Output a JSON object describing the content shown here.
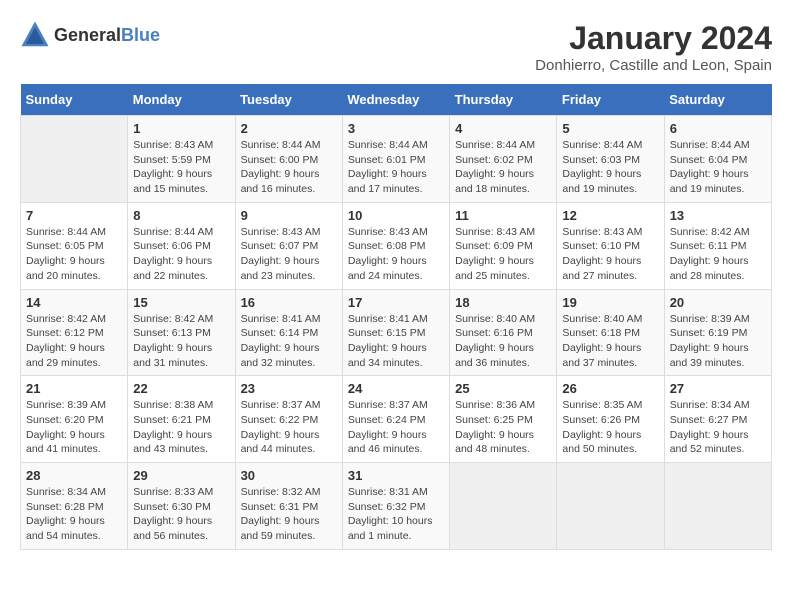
{
  "header": {
    "logo_general": "General",
    "logo_blue": "Blue",
    "month_title": "January 2024",
    "location": "Donhierro, Castille and Leon, Spain"
  },
  "calendar": {
    "days_of_week": [
      "Sunday",
      "Monday",
      "Tuesday",
      "Wednesday",
      "Thursday",
      "Friday",
      "Saturday"
    ],
    "weeks": [
      [
        {
          "day": "",
          "info": ""
        },
        {
          "day": "1",
          "info": "Sunrise: 8:43 AM\nSunset: 5:59 PM\nDaylight: 9 hours\nand 15 minutes."
        },
        {
          "day": "2",
          "info": "Sunrise: 8:44 AM\nSunset: 6:00 PM\nDaylight: 9 hours\nand 16 minutes."
        },
        {
          "day": "3",
          "info": "Sunrise: 8:44 AM\nSunset: 6:01 PM\nDaylight: 9 hours\nand 17 minutes."
        },
        {
          "day": "4",
          "info": "Sunrise: 8:44 AM\nSunset: 6:02 PM\nDaylight: 9 hours\nand 18 minutes."
        },
        {
          "day": "5",
          "info": "Sunrise: 8:44 AM\nSunset: 6:03 PM\nDaylight: 9 hours\nand 19 minutes."
        },
        {
          "day": "6",
          "info": "Sunrise: 8:44 AM\nSunset: 6:04 PM\nDaylight: 9 hours\nand 19 minutes."
        }
      ],
      [
        {
          "day": "7",
          "info": "Sunrise: 8:44 AM\nSunset: 6:05 PM\nDaylight: 9 hours\nand 20 minutes."
        },
        {
          "day": "8",
          "info": "Sunrise: 8:44 AM\nSunset: 6:06 PM\nDaylight: 9 hours\nand 22 minutes."
        },
        {
          "day": "9",
          "info": "Sunrise: 8:43 AM\nSunset: 6:07 PM\nDaylight: 9 hours\nand 23 minutes."
        },
        {
          "day": "10",
          "info": "Sunrise: 8:43 AM\nSunset: 6:08 PM\nDaylight: 9 hours\nand 24 minutes."
        },
        {
          "day": "11",
          "info": "Sunrise: 8:43 AM\nSunset: 6:09 PM\nDaylight: 9 hours\nand 25 minutes."
        },
        {
          "day": "12",
          "info": "Sunrise: 8:43 AM\nSunset: 6:10 PM\nDaylight: 9 hours\nand 27 minutes."
        },
        {
          "day": "13",
          "info": "Sunrise: 8:42 AM\nSunset: 6:11 PM\nDaylight: 9 hours\nand 28 minutes."
        }
      ],
      [
        {
          "day": "14",
          "info": "Sunrise: 8:42 AM\nSunset: 6:12 PM\nDaylight: 9 hours\nand 29 minutes."
        },
        {
          "day": "15",
          "info": "Sunrise: 8:42 AM\nSunset: 6:13 PM\nDaylight: 9 hours\nand 31 minutes."
        },
        {
          "day": "16",
          "info": "Sunrise: 8:41 AM\nSunset: 6:14 PM\nDaylight: 9 hours\nand 32 minutes."
        },
        {
          "day": "17",
          "info": "Sunrise: 8:41 AM\nSunset: 6:15 PM\nDaylight: 9 hours\nand 34 minutes."
        },
        {
          "day": "18",
          "info": "Sunrise: 8:40 AM\nSunset: 6:16 PM\nDaylight: 9 hours\nand 36 minutes."
        },
        {
          "day": "19",
          "info": "Sunrise: 8:40 AM\nSunset: 6:18 PM\nDaylight: 9 hours\nand 37 minutes."
        },
        {
          "day": "20",
          "info": "Sunrise: 8:39 AM\nSunset: 6:19 PM\nDaylight: 9 hours\nand 39 minutes."
        }
      ],
      [
        {
          "day": "21",
          "info": "Sunrise: 8:39 AM\nSunset: 6:20 PM\nDaylight: 9 hours\nand 41 minutes."
        },
        {
          "day": "22",
          "info": "Sunrise: 8:38 AM\nSunset: 6:21 PM\nDaylight: 9 hours\nand 43 minutes."
        },
        {
          "day": "23",
          "info": "Sunrise: 8:37 AM\nSunset: 6:22 PM\nDaylight: 9 hours\nand 44 minutes."
        },
        {
          "day": "24",
          "info": "Sunrise: 8:37 AM\nSunset: 6:24 PM\nDaylight: 9 hours\nand 46 minutes."
        },
        {
          "day": "25",
          "info": "Sunrise: 8:36 AM\nSunset: 6:25 PM\nDaylight: 9 hours\nand 48 minutes."
        },
        {
          "day": "26",
          "info": "Sunrise: 8:35 AM\nSunset: 6:26 PM\nDaylight: 9 hours\nand 50 minutes."
        },
        {
          "day": "27",
          "info": "Sunrise: 8:34 AM\nSunset: 6:27 PM\nDaylight: 9 hours\nand 52 minutes."
        }
      ],
      [
        {
          "day": "28",
          "info": "Sunrise: 8:34 AM\nSunset: 6:28 PM\nDaylight: 9 hours\nand 54 minutes."
        },
        {
          "day": "29",
          "info": "Sunrise: 8:33 AM\nSunset: 6:30 PM\nDaylight: 9 hours\nand 56 minutes."
        },
        {
          "day": "30",
          "info": "Sunrise: 8:32 AM\nSunset: 6:31 PM\nDaylight: 9 hours\nand 59 minutes."
        },
        {
          "day": "31",
          "info": "Sunrise: 8:31 AM\nSunset: 6:32 PM\nDaylight: 10 hours\nand 1 minute."
        },
        {
          "day": "",
          "info": ""
        },
        {
          "day": "",
          "info": ""
        },
        {
          "day": "",
          "info": ""
        }
      ]
    ]
  }
}
